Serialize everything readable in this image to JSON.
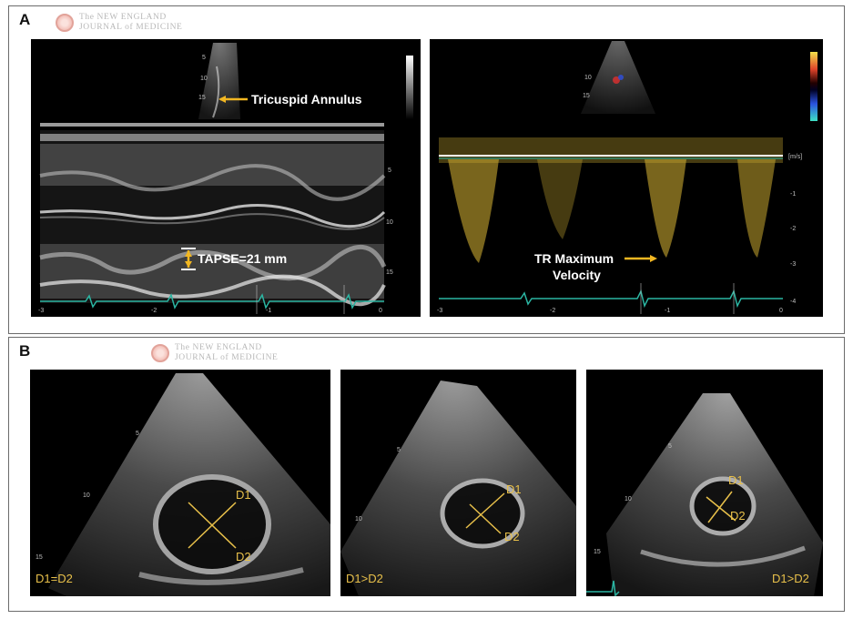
{
  "panels": {
    "a": {
      "letter": "A"
    },
    "b": {
      "letter": "B"
    }
  },
  "journal": {
    "line1": "The NEW ENGLAND",
    "line2": "JOURNAL of MEDICINE"
  },
  "mmode": {
    "annotation_arrow_label": "Tricuspid Annulus",
    "measurement_label": "TAPSE=21 mm",
    "depth_ticks": [
      "5",
      "10",
      "15"
    ],
    "inset_depth_ticks": [
      "5",
      "10",
      "15"
    ],
    "time_ticks": [
      "-3",
      "-2",
      "-1",
      "0"
    ]
  },
  "doppler": {
    "annotation_line1": "TR Maximum",
    "annotation_line2": "Velocity",
    "unit_label": "[m/s]",
    "velocity_ticks": [
      "-1",
      "-2",
      "-3",
      "-4"
    ],
    "time_ticks": [
      "-3",
      "-2",
      "-1",
      "0"
    ],
    "inset_depth_ticks": [
      "10",
      "15"
    ]
  },
  "echo_b": [
    {
      "d1": "D1",
      "d2": "D2",
      "condition": "D1=D2",
      "depth_ticks": [
        "5",
        "10",
        "15"
      ]
    },
    {
      "d1": "D1",
      "d2": "D2",
      "condition": "D1>D2",
      "depth_ticks": [
        "5",
        "10"
      ]
    },
    {
      "d1": "D1",
      "d2": "D2",
      "condition": "D1>D2",
      "depth_ticks": [
        "5",
        "10",
        "15"
      ]
    }
  ],
  "colors": {
    "annotation_yellow": "#e8c04a",
    "arrow_yellow": "#f2b722",
    "ecg_teal": "#2bb5a2"
  }
}
